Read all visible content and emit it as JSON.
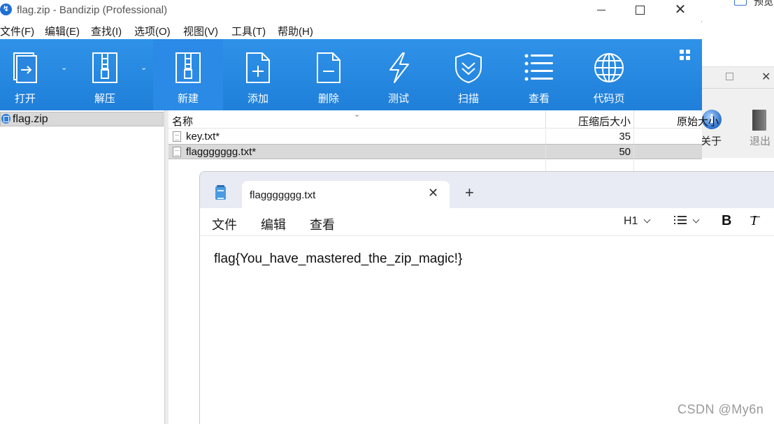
{
  "background_window": {
    "preview_label": "预览",
    "about_label": "关于",
    "exit_label": "退出"
  },
  "bandizip": {
    "title": "flag.zip - Bandizip (Professional)",
    "menu": [
      "文件(F)",
      "编辑(E)",
      "查找(I)",
      "选项(O)",
      "视图(V)",
      "工具(T)",
      "帮助(H)"
    ],
    "toolbar": [
      {
        "label": "打开",
        "icon": "open-icon"
      },
      {
        "label": "解压",
        "icon": "extract-icon"
      },
      {
        "label": "新建",
        "icon": "new-archive-icon"
      },
      {
        "label": "添加",
        "icon": "add-file-icon"
      },
      {
        "label": "删除",
        "icon": "delete-file-icon"
      },
      {
        "label": "测试",
        "icon": "test-icon"
      },
      {
        "label": "扫描",
        "icon": "scan-shield-icon"
      },
      {
        "label": "查看",
        "icon": "view-list-icon"
      },
      {
        "label": "代码页",
        "icon": "codepage-globe-icon"
      }
    ],
    "tree": [
      {
        "label": "flag.zip"
      }
    ],
    "columns": {
      "name": "名称",
      "packed": "压缩后大小",
      "original": "原始大小"
    },
    "files": [
      {
        "name": "key.txt*",
        "packed": "35"
      },
      {
        "name": "flaggggggg.txt*",
        "packed": "50",
        "selected": true
      }
    ],
    "colors": {
      "toolbar": "#2084dd",
      "selection": "#d9d9d9"
    }
  },
  "notepad": {
    "tab_title": "flaggggggg.txt",
    "new_tab": "+",
    "close_tab": "✕",
    "menu": [
      "文件",
      "编辑",
      "查看"
    ],
    "heading_select": "H1",
    "bold": "B",
    "italic": "I",
    "content": "flag{You_have_mastered_the_zip_magic!}"
  },
  "watermark": "CSDN @My6n"
}
